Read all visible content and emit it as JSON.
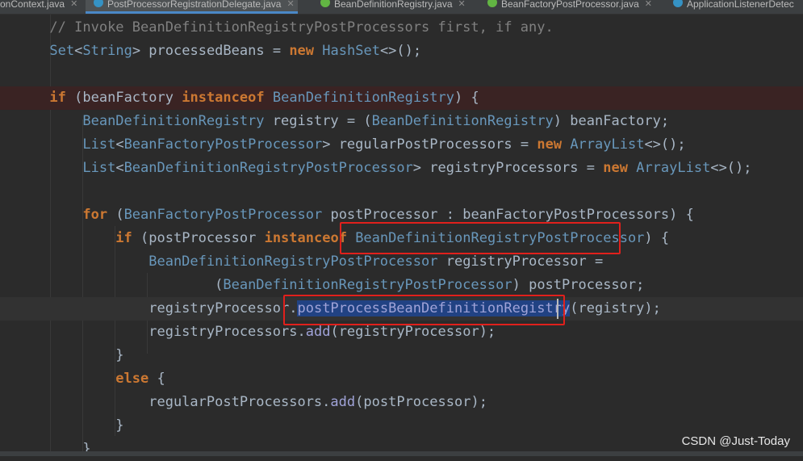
{
  "tabs": [
    {
      "label": "onContext.java",
      "icon": "class-icon"
    },
    {
      "label": "PostProcessorRegistrationDelegate.java",
      "icon": "class-icon",
      "active": true
    },
    {
      "label": "BeanDefinitionRegistry.java",
      "icon": "interface-icon"
    },
    {
      "label": "BeanFactoryPostProcessor.java",
      "icon": "interface-icon"
    },
    {
      "label": "ApplicationListenerDetec",
      "icon": "class-icon"
    }
  ],
  "code": {
    "l1_comment": "// Invoke BeanDefinitionRegistryPostProcessors first, if any.",
    "set_type": "Set",
    "string_type": "String",
    "processed_beans": "processedBeans",
    "new_kw": "new",
    "hashset": "HashSet",
    "if_kw": "if",
    "instanceof_kw": "instanceof",
    "bean_factory": "beanFactory",
    "bdr": "BeanDefinitionRegistry",
    "registry": "registry",
    "list_type": "List",
    "bfpp": "BeanFactoryPostProcessor",
    "regular_pps": "regularPostProcessors",
    "arraylist": "ArrayList",
    "bdrpp": "BeanDefinitionRegistryPostProcessor",
    "registry_processors": "registryProcessors",
    "for_kw": "for",
    "post_processor": "postProcessor",
    "bf_pps": "beanFactoryPostProcessors",
    "registry_processor": "registryProcessor",
    "method_pbdr": "postProcessBeanDefinitionRegistry",
    "add_method": "add",
    "else_kw": "else"
  },
  "watermark": "CSDN @Just-Today",
  "colors": {
    "keyword": "#cc7832",
    "type": "#6897bb",
    "comment": "#808080",
    "text": "#a9b7c6",
    "highlight_box": "#e0201c",
    "selection": "#214283"
  }
}
